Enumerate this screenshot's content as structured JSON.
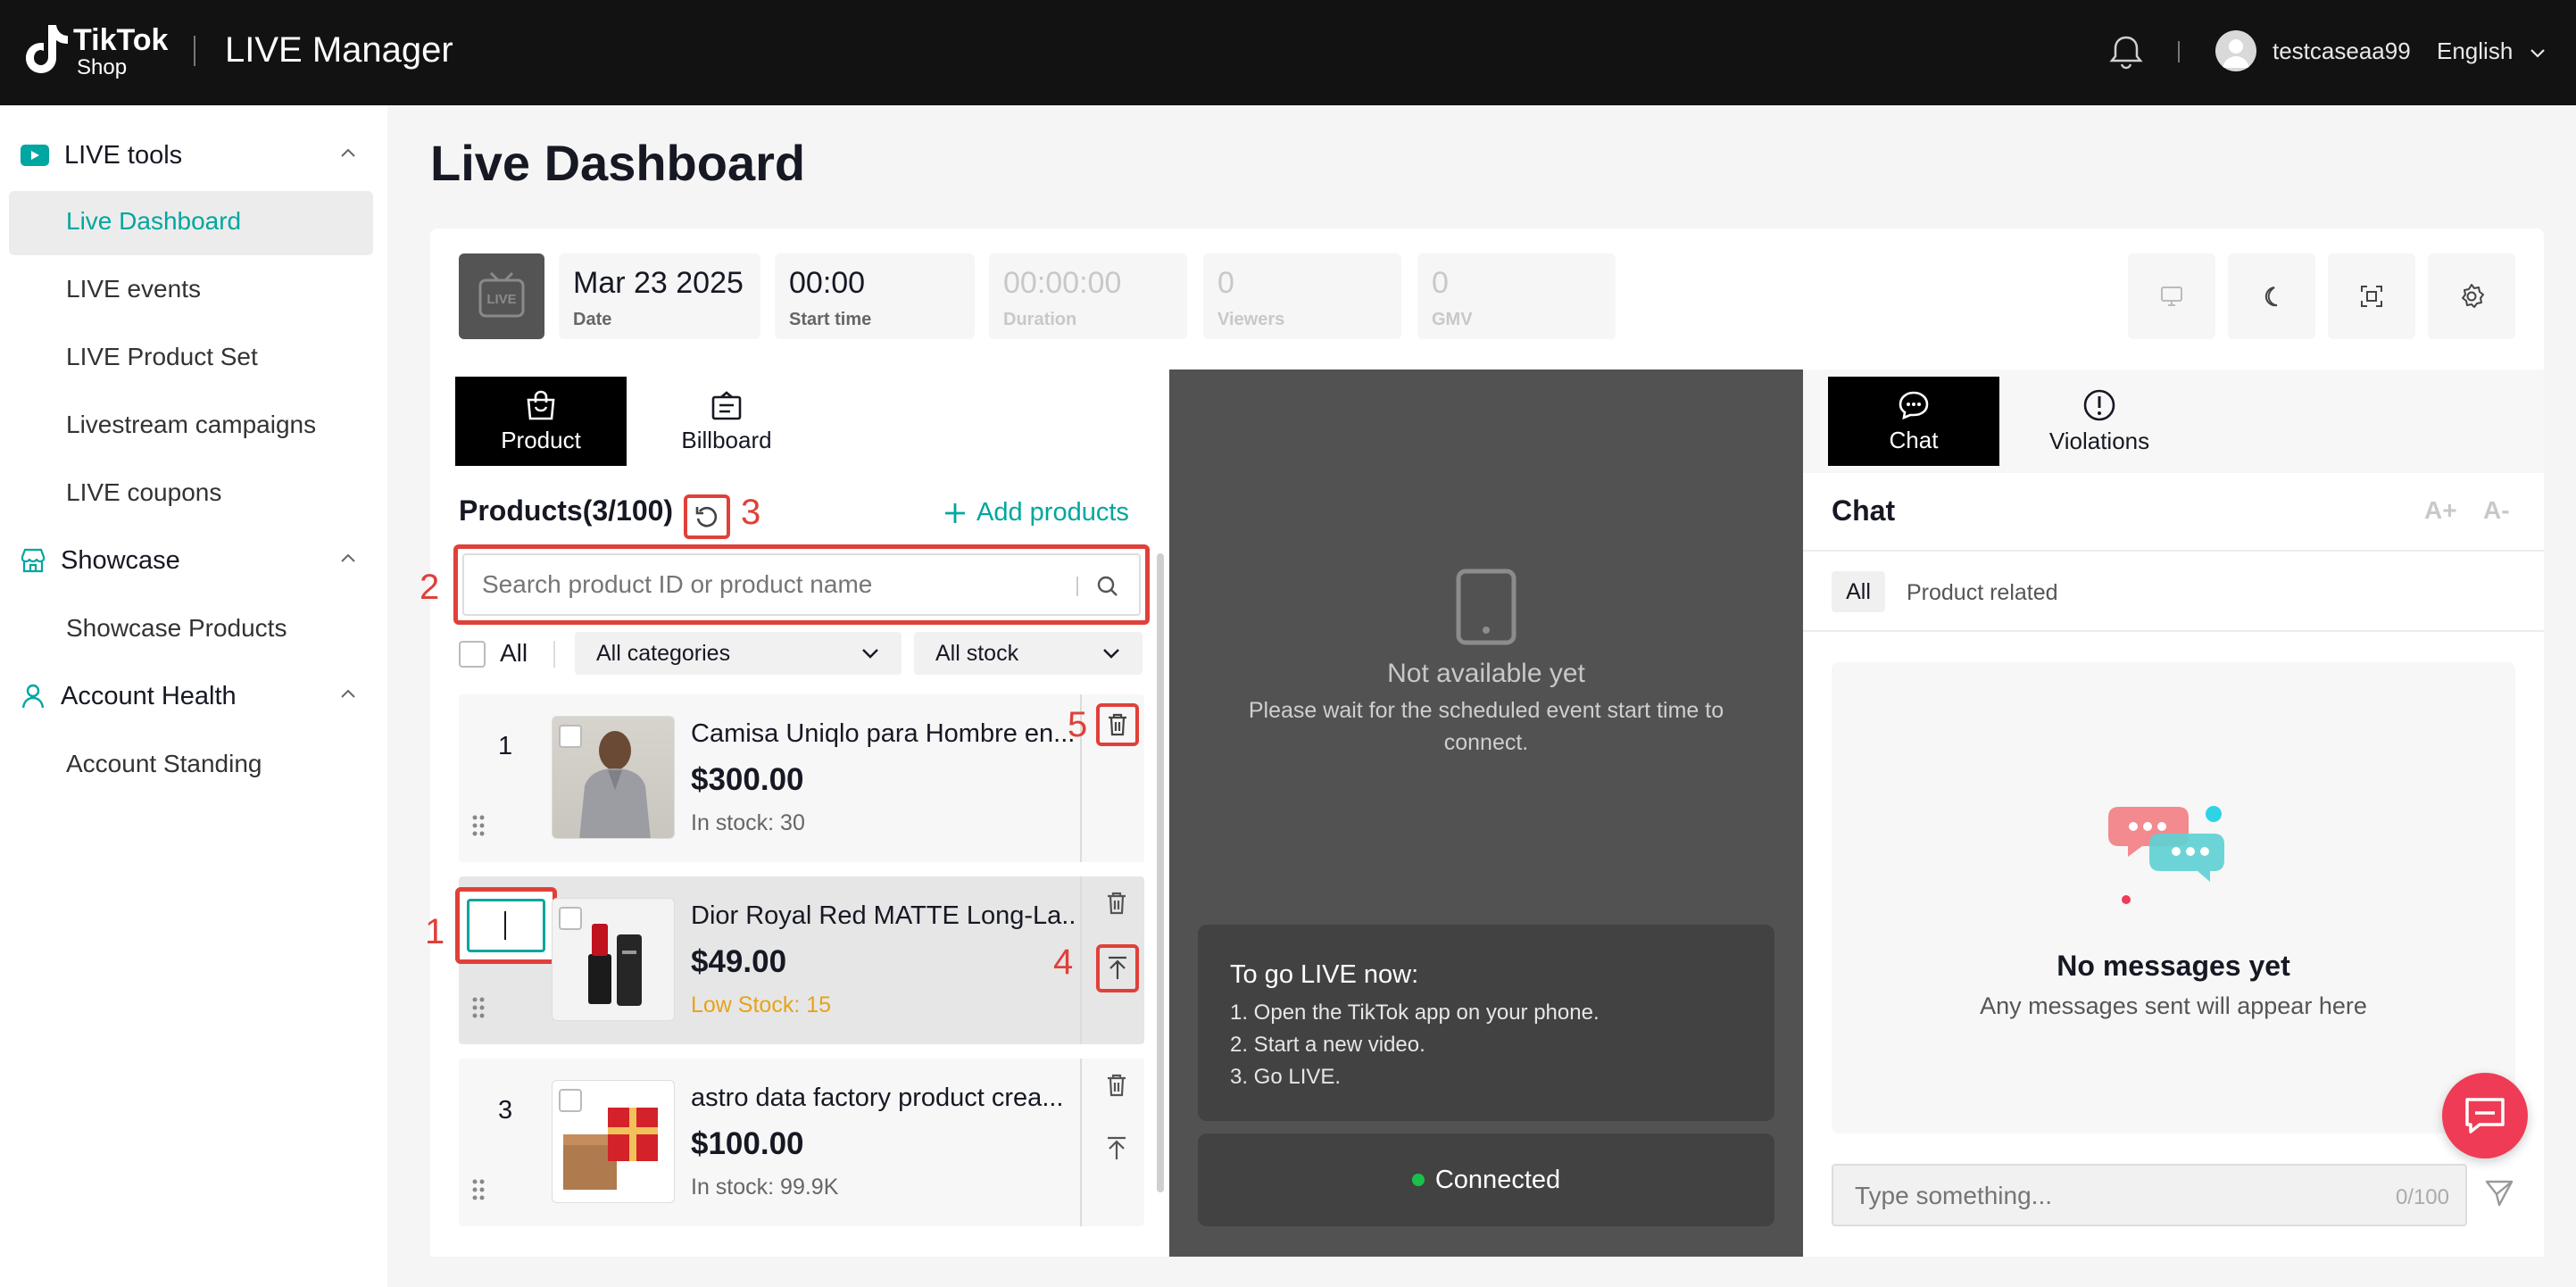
{
  "topbar": {
    "logo_tiktok": "TikTok",
    "logo_shop": "Shop",
    "app_title": "LIVE Manager",
    "username": "testcaseaa99",
    "language": "English"
  },
  "sidebar": {
    "sections": [
      {
        "label": "LIVE tools",
        "items": [
          "Live Dashboard",
          "LIVE events",
          "LIVE Product Set",
          "Livestream campaigns",
          "LIVE coupons"
        ]
      },
      {
        "label": "Showcase",
        "items": [
          "Showcase Products"
        ]
      },
      {
        "label": "Account Health",
        "items": [
          "Account Standing"
        ]
      }
    ],
    "active": "Live Dashboard"
  },
  "page": {
    "title": "Live Dashboard"
  },
  "stats": {
    "live_badge": "LIVE",
    "date": {
      "value": "Mar 23 2025",
      "label": "Date"
    },
    "start_time": {
      "value": "00:00",
      "label": "Start time"
    },
    "duration": {
      "value": "00:00:00",
      "label": "Duration"
    },
    "viewers": {
      "value": "0",
      "label": "Viewers"
    },
    "gmv": {
      "value": "0",
      "label": "GMV"
    }
  },
  "product_panel": {
    "tabs": [
      "Product",
      "Billboard"
    ],
    "heading": "Products(3/100)",
    "add_products": "Add products",
    "search_placeholder": "Search product ID or product name",
    "select_all": "All",
    "category_filter": "All categories",
    "stock_filter": "All stock",
    "products": [
      {
        "index": "1",
        "name": "Camisa Uniqlo para Hombre en...",
        "price": "$300.00",
        "stock": "In stock: 30",
        "low": false
      },
      {
        "index": "",
        "name": "Dior Royal Red MATTE Long-La...",
        "price": "$49.00",
        "stock": "Low Stock: 15",
        "low": true
      },
      {
        "index": "3",
        "name": "astro data factory product crea...",
        "price": "$100.00",
        "stock": "In stock: 99.9K",
        "low": false
      }
    ]
  },
  "annotations": [
    "1",
    "2",
    "3",
    "4",
    "5"
  ],
  "video_panel": {
    "not_available": "Not available yet",
    "wait_message": "Please wait for the scheduled event start time to connect.",
    "golive_title": "To go LIVE now:",
    "steps": [
      "1. Open the TikTok app on your phone.",
      "2. Start a new video.",
      "3. Go LIVE."
    ],
    "status": "Connected"
  },
  "chat_panel": {
    "tabs": [
      "Chat",
      "Violations"
    ],
    "title": "Chat",
    "font_increase": "A+",
    "font_decrease": "A-",
    "filters": [
      "All",
      "Product related"
    ],
    "empty_title": "No messages yet",
    "empty_subtitle": "Any messages sent will appear here",
    "input_placeholder": "Type something...",
    "counter": "0/100"
  },
  "colors": {
    "accent": "#00a6a0",
    "annotation": "#e0403a",
    "fab": "#ef3b55"
  }
}
